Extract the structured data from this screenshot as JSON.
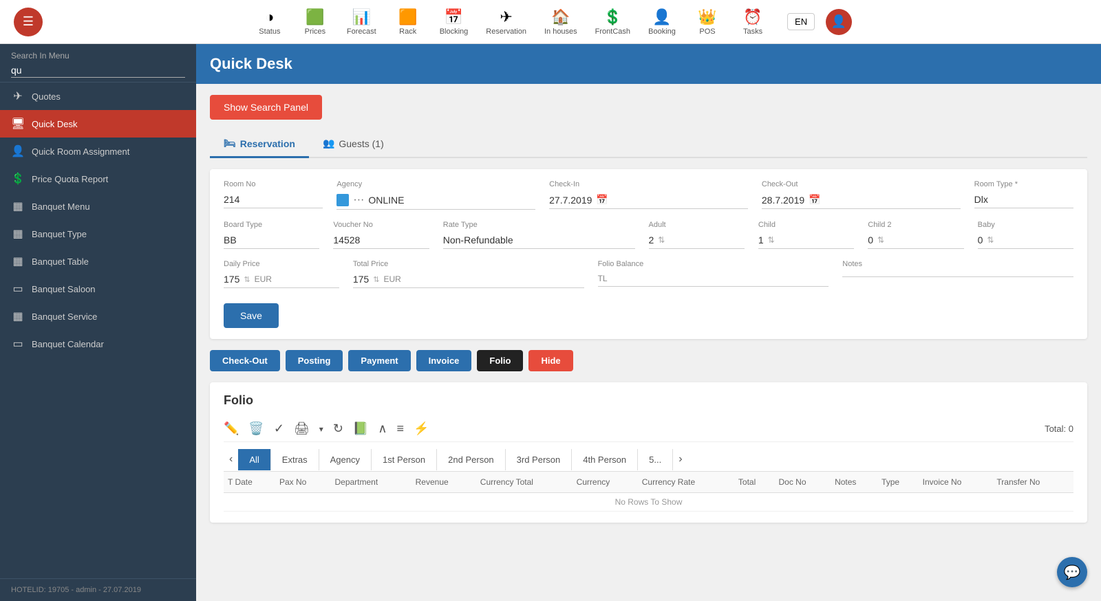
{
  "topNav": {
    "items": [
      {
        "id": "status",
        "label": "Status",
        "icon": "◑"
      },
      {
        "id": "prices",
        "label": "Prices",
        "icon": "🟩"
      },
      {
        "id": "forecast",
        "label": "Forecast",
        "icon": "📊"
      },
      {
        "id": "rack",
        "label": "Rack",
        "icon": "🟧"
      },
      {
        "id": "blocking",
        "label": "Blocking",
        "icon": "📅"
      },
      {
        "id": "reservation",
        "label": "Reservation",
        "icon": "✈"
      },
      {
        "id": "inhouses",
        "label": "In houses",
        "icon": "🏠"
      },
      {
        "id": "frontcash",
        "label": "FrontCash",
        "icon": "💲"
      },
      {
        "id": "booking",
        "label": "Booking",
        "icon": "👤"
      },
      {
        "id": "pos",
        "label": "POS",
        "icon": "👑"
      },
      {
        "id": "tasks",
        "label": "Tasks",
        "icon": "⏰"
      }
    ],
    "lang": "EN"
  },
  "sidebar": {
    "searchLabel": "Search In Menu",
    "searchValue": "qu",
    "items": [
      {
        "id": "quotes",
        "label": "Quotes",
        "icon": "✈",
        "active": false
      },
      {
        "id": "quick-desk",
        "label": "Quick Desk",
        "icon": "🖥",
        "active": true
      },
      {
        "id": "quick-room",
        "label": "Quick Room Assignment",
        "icon": "👤",
        "active": false
      },
      {
        "id": "price-quota",
        "label": "Price Quota Report",
        "icon": "💲",
        "active": false
      },
      {
        "id": "banquet-menu",
        "label": "Banquet Menu",
        "icon": "▦",
        "active": false
      },
      {
        "id": "banquet-type",
        "label": "Banquet Type",
        "icon": "▦",
        "active": false
      },
      {
        "id": "banquet-table",
        "label": "Banquet Table",
        "icon": "▦",
        "active": false
      },
      {
        "id": "banquet-saloon",
        "label": "Banquet Saloon",
        "icon": "▭",
        "active": false
      },
      {
        "id": "banquet-service",
        "label": "Banquet Service",
        "icon": "▦",
        "active": false
      },
      {
        "id": "banquet-calendar",
        "label": "Banquet Calendar",
        "icon": "▭",
        "active": false
      }
    ],
    "footer": "HOTELID: 19705 - admin - 27.07.2019"
  },
  "page": {
    "title": "Quick Desk",
    "showSearchBtn": "Show Search Panel"
  },
  "tabs": [
    {
      "id": "reservation",
      "label": "Reservation",
      "icon": "🛏",
      "active": true
    },
    {
      "id": "guests",
      "label": "Guests (1)",
      "icon": "👥",
      "active": false
    }
  ],
  "form": {
    "fields": {
      "roomNo": {
        "label": "Room No",
        "value": "214"
      },
      "agency": {
        "label": "Agency",
        "value": "ONLINE"
      },
      "checkIn": {
        "label": "Check-In",
        "value": "27.7.2019"
      },
      "checkOut": {
        "label": "Check-Out",
        "value": "28.7.2019"
      },
      "roomType": {
        "label": "Room Type *",
        "value": "Dlx"
      },
      "boardType": {
        "label": "Board Type",
        "value": "BB"
      },
      "voucherNo": {
        "label": "Voucher No",
        "value": "14528"
      },
      "rateType": {
        "label": "Rate Type",
        "value": "Non-Refundable"
      },
      "adult": {
        "label": "Adult",
        "value": "2"
      },
      "child": {
        "label": "Child",
        "value": "1"
      },
      "child2": {
        "label": "Child 2",
        "value": "0"
      },
      "baby": {
        "label": "Baby",
        "value": "0"
      },
      "dailyPrice": {
        "label": "Daily Price",
        "value": "175"
      },
      "dailyCurrency": "EUR",
      "totalPrice": {
        "label": "Total Price",
        "value": "175"
      },
      "totalCurrency": "EUR",
      "folioBalance": {
        "label": "Folio Balance",
        "value": ""
      },
      "folioBalanceCurrency": "TL",
      "notes": {
        "label": "Notes",
        "value": ""
      }
    },
    "saveBtn": "Save"
  },
  "actionButtons": [
    {
      "id": "checkout",
      "label": "Check-Out",
      "style": "blue"
    },
    {
      "id": "posting",
      "label": "Posting",
      "style": "blue"
    },
    {
      "id": "payment",
      "label": "Payment",
      "style": "blue"
    },
    {
      "id": "invoice",
      "label": "Invoice",
      "style": "blue"
    },
    {
      "id": "folio",
      "label": "Folio",
      "style": "black"
    },
    {
      "id": "hide",
      "label": "Hide",
      "style": "red"
    }
  ],
  "folio": {
    "title": "Folio",
    "totalLabel": "Total: 0",
    "tabs": [
      {
        "id": "all",
        "label": "All",
        "active": true
      },
      {
        "id": "extras",
        "label": "Extras",
        "active": false
      },
      {
        "id": "agency",
        "label": "Agency",
        "active": false
      },
      {
        "id": "1st-person",
        "label": "1st Person",
        "active": false
      },
      {
        "id": "2nd-person",
        "label": "2nd Person",
        "active": false
      },
      {
        "id": "3rd-person",
        "label": "3rd Person",
        "active": false
      },
      {
        "id": "4th-person",
        "label": "4th Person",
        "active": false
      },
      {
        "id": "5th",
        "label": "5...",
        "active": false
      }
    ],
    "columns": [
      "T Date",
      "Pax No",
      "Department",
      "Revenue",
      "Currency Total",
      "Currency",
      "Currency Rate",
      "Total",
      "Doc No",
      "Notes",
      "Type",
      "Invoice No",
      "Transfer No"
    ],
    "noRowsText": "No Rows To Show"
  }
}
